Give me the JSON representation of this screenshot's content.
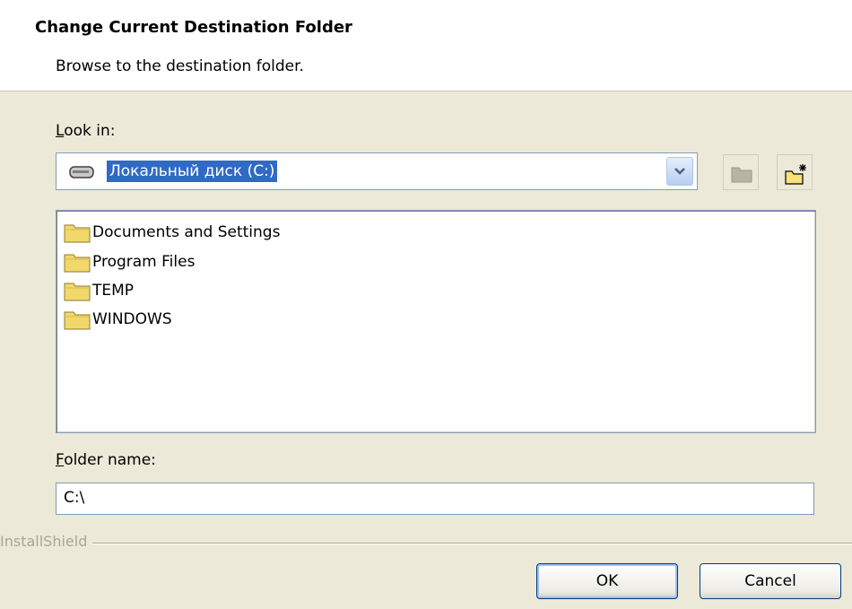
{
  "header": {
    "title": "Change Current Destination Folder",
    "subtitle": "Browse to the destination folder."
  },
  "look_in": {
    "label_accel": "L",
    "label_rest": "ook in:",
    "value": "Локальный диск (C:)",
    "drive_icon": "drive-icon"
  },
  "toolbar": {
    "up_icon": "up-folder-icon",
    "new_folder_icon": "new-folder-icon"
  },
  "folders": [
    {
      "name": "Documents and Settings"
    },
    {
      "name": "Program Files"
    },
    {
      "name": "TEMP"
    },
    {
      "name": "WINDOWS"
    }
  ],
  "folder_name": {
    "label_accel": "F",
    "label_rest": "older name:",
    "value": "C:\\"
  },
  "brand": "InstallShield",
  "buttons": {
    "ok": "OK",
    "cancel": "Cancel"
  },
  "colors": {
    "dialog_bg": "#ECE9D8",
    "selection": "#316AC5",
    "border": "#7F9DB9",
    "folder_yellow": "#F2D86B"
  }
}
